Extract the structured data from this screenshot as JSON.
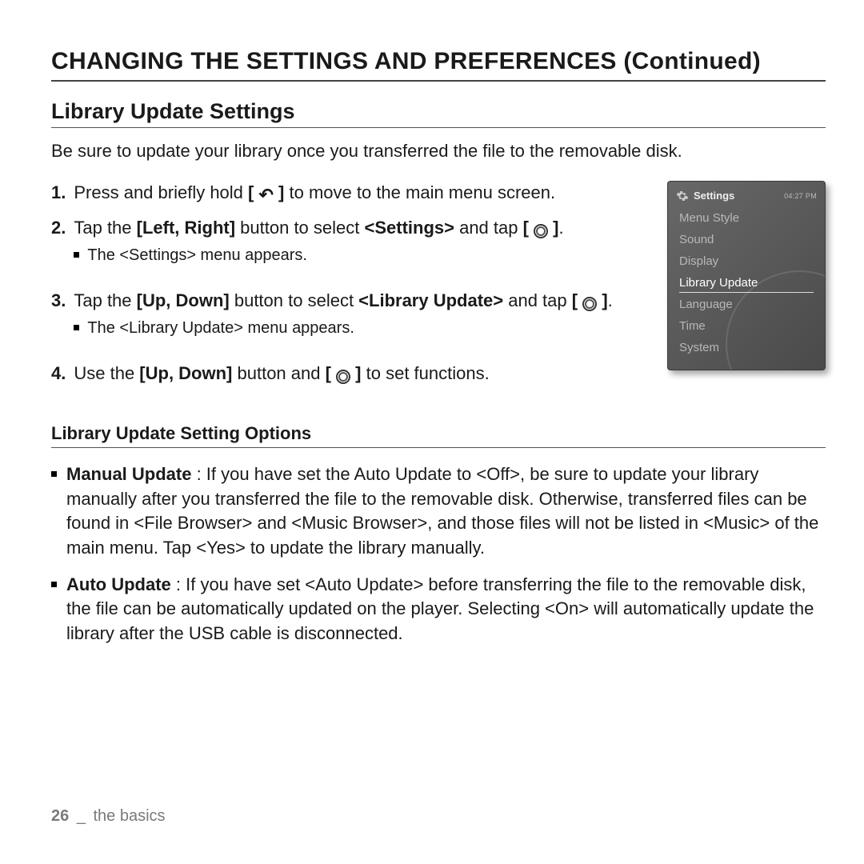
{
  "title": "CHANGING THE SETTINGS AND PREFERENCES (Continued)",
  "section": "Library Update Settings",
  "intro": "Be sure to update your library once you transferred the file to the removable disk.",
  "steps": [
    {
      "num": "1.",
      "pre": "Press and briefly hold ",
      "icon": "back",
      "post": " to move to the main menu screen."
    },
    {
      "num": "2.",
      "pre": "Tap the ",
      "bold1": "[Left, Right]",
      "mid": " button to select ",
      "bold2": "<Settings>",
      "post_pre": " and tap ",
      "icon": "circle",
      "post": ".",
      "sub": "The <Settings> menu appears."
    },
    {
      "num": "3.",
      "pre": "Tap the ",
      "bold1": "[Up, Down]",
      "mid": " button to select ",
      "bold2": "<Library Update>",
      "post_pre": " and tap ",
      "icon": "circle",
      "post": ".",
      "sub": "The <Library Update> menu appears."
    },
    {
      "num": "4.",
      "pre": "Use the ",
      "bold1": "[Up, Down]",
      "mid": " button and ",
      "icon": "circle",
      "post": " to set functions."
    }
  ],
  "device": {
    "title": "Settings",
    "status": "04:27 PM",
    "items": [
      "Menu Style",
      "Sound",
      "Display",
      "Library Update",
      "Language",
      "Time",
      "System"
    ],
    "selected": "Library Update"
  },
  "options_title": "Library Update Setting Options",
  "options": [
    {
      "bold": "Manual Update",
      "text": " : If you have set the Auto Update to <Off>, be sure to update your library manually after you transferred the file to the removable disk. Otherwise, transferred files can be found in <File Browser> and <Music Browser>, and those files will not be listed in <Music> of the main menu. Tap <Yes> to update the library manually."
    },
    {
      "bold": "Auto Update",
      "text": " : If you have set <Auto Update> before transferring the file to the removable disk, the file can be automatically updated on the player. Selecting <On> will automatically update the library after the USB cable is disconnected."
    }
  ],
  "footer": {
    "page": "26",
    "sep": "_",
    "label": "the basics"
  },
  "icons": {
    "back_bracket_open": "[ ",
    "back_bracket_close": " ]",
    "circle_bracket_open": "[ ",
    "circle_bracket_close": " ]"
  }
}
